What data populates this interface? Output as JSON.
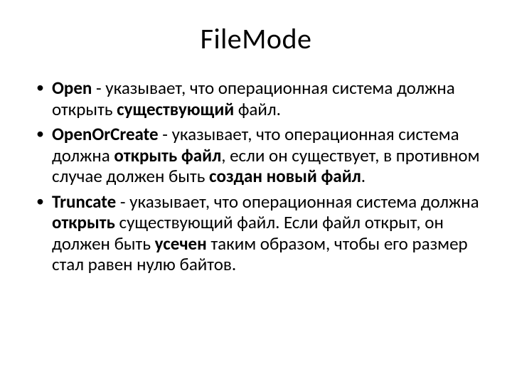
{
  "title": "FileMode",
  "items": [
    {
      "term": "Open",
      "p1": " - указывает, что операционная система должна открыть ",
      "b1": "существующий",
      "p2": " файл.",
      "b2": "",
      "p3": "",
      "b3": "",
      "p4": ""
    },
    {
      "term": "OpenOrCreate",
      "p1": " - указывает, что операционная система должна ",
      "b1": "открыть файл",
      "p2": ", если он существует, в противном случае должен быть ",
      "b2": "создан новый файл",
      "p3": ".",
      "b3": "",
      "p4": ""
    },
    {
      "term": "Truncate",
      "p1": " - указывает, что операционная система должна ",
      "b1": "открыть",
      "p2": " существующий файл. Если файл открыт, он должен быть ",
      "b2": "усечен",
      "p3": " таким образом, чтобы его размер стал равен нулю байтов.",
      "b3": "",
      "p4": ""
    }
  ]
}
